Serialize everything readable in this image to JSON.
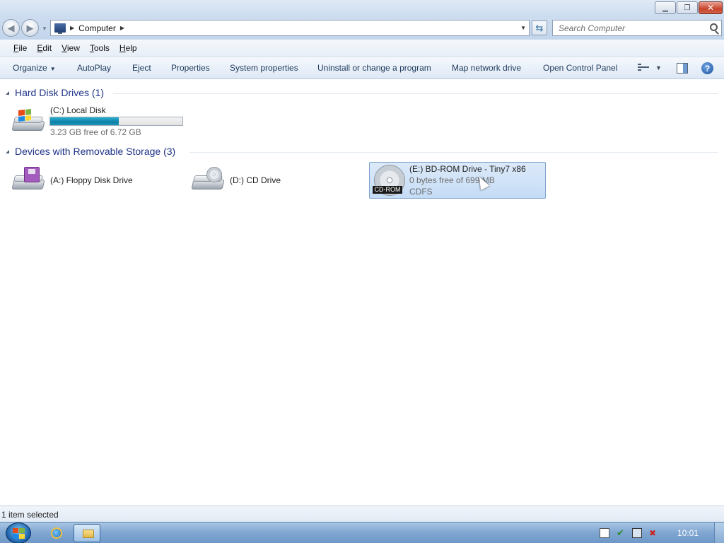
{
  "window": {
    "minimize_glyph": "▁",
    "restore_glyph": "❐",
    "close_glyph": "✕"
  },
  "address": {
    "crumb": "Computer",
    "search_placeholder": "Search Computer"
  },
  "menu": {
    "items": [
      {
        "key": "F",
        "rest": "ile"
      },
      {
        "key": "E",
        "rest": "dit"
      },
      {
        "key": "V",
        "rest": "iew"
      },
      {
        "key": "T",
        "rest": "ools"
      },
      {
        "key": "H",
        "rest": "elp"
      }
    ]
  },
  "commands": {
    "organize": "Organize",
    "autoplay": "AutoPlay",
    "eject": "Eject",
    "properties": "Properties",
    "system_properties": "System properties",
    "uninstall": "Uninstall or change a program",
    "map_drive": "Map network drive",
    "control_panel": "Open Control Panel",
    "help_glyph": "?"
  },
  "groups": {
    "hard_disks": "Hard Disk Drives (1)",
    "removable": "Devices with Removable Storage (3)"
  },
  "drives": {
    "c": {
      "label": "(C:) Local Disk",
      "free": "3.23 GB free of 6.72 GB",
      "used_fraction": 0.52,
      "bar_color": "#1a98bb"
    },
    "a": {
      "label": "(A:) Floppy Disk Drive"
    },
    "d": {
      "label": "(D:) CD Drive"
    },
    "e": {
      "label": "(E:) BD-ROM Drive - Tiny7 x86",
      "free": "0 bytes free of 699 MB",
      "fs": "CDFS",
      "badge": "CD-ROM",
      "selected": true
    }
  },
  "status": {
    "text": "1 item selected"
  },
  "taskbar": {
    "clock": "10:01"
  },
  "colors": {
    "accent": "#1e3287",
    "selection": "#c5dcf6"
  }
}
